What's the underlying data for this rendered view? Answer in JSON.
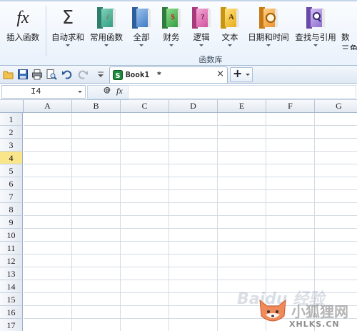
{
  "ribbon": {
    "insert_function": "插入函数",
    "autosum": "自动求和",
    "common": "常用函数",
    "all": "全部",
    "finance": "财务",
    "logic": "逻辑",
    "text": "文本",
    "datetime": "日期和时间",
    "lookup": "查找与引用",
    "math_partial": "数",
    "trig_partial": "三角",
    "group_label": "函数库",
    "icons": {
      "fx": "fx",
      "sigma": "Σ",
      "finance_glyph": "$",
      "logic_glyph": "?",
      "text_glyph": "A"
    }
  },
  "toolbar": {
    "doc_tab_name": "Book1",
    "doc_modified_marker": "*",
    "close_glyph": "×",
    "add_glyph": "+"
  },
  "formula_bar": {
    "name_box_value": "I4",
    "fx_label": "fx",
    "at_glyph": "@"
  },
  "sheet": {
    "columns": [
      "A",
      "B",
      "C",
      "D",
      "E",
      "F",
      "G"
    ],
    "rows": [
      "1",
      "2",
      "3",
      "4",
      "5",
      "6",
      "7",
      "8",
      "9",
      "10",
      "11",
      "12",
      "13",
      "14",
      "15",
      "16",
      "17"
    ],
    "active_row": "4"
  },
  "watermark": {
    "baidu": "Baidu 经验",
    "site_cn": "小狐狸网",
    "site_url": "XHLKS.CN"
  },
  "colors": {
    "accent": "#1e8a3c",
    "active_row": "#f9e68a"
  }
}
